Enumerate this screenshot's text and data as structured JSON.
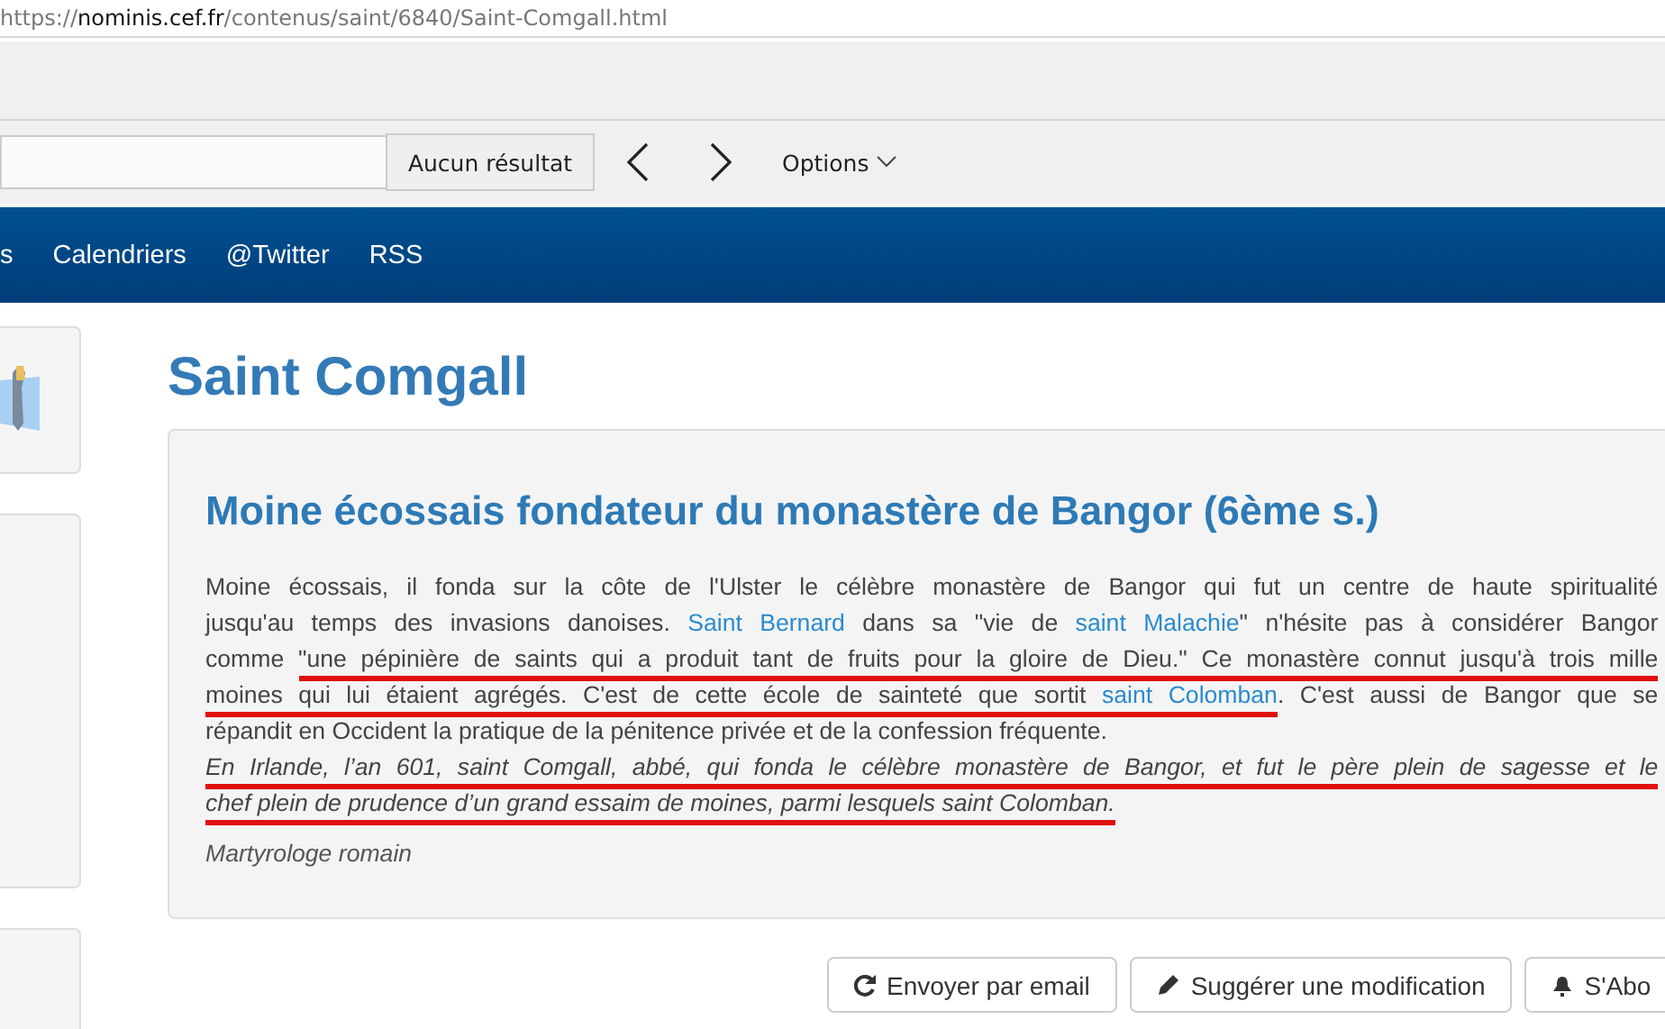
{
  "address_bar": {
    "scheme": "https://",
    "host": "nominis.cef.fr",
    "path": "/contenus/saint/6840/Saint-Comgall.html"
  },
  "find_bar": {
    "result_button": "Aucun résultat",
    "options": "Options"
  },
  "nav": [
    "s",
    "Calendriers",
    "@Twitter",
    "RSS"
  ],
  "sidebar_cards": [
    {
      "kind": "picture"
    },
    {
      "kind": "empty"
    },
    {
      "kind": "empty"
    }
  ],
  "title": "Saint Comgall",
  "panel": {
    "heading": "Moine écossais fondateur du monastère de Bangor (6ème s.)",
    "lines": [
      {
        "italic": false,
        "segments": [
          {
            "text": "Moine écossais, il fonda sur la côte de l'Ulster le célèbre monastère de Bangor qui fut un centre de haute spiritualité",
            "link": false,
            "marked": false
          }
        ]
      },
      {
        "italic": false,
        "segments": [
          {
            "text": "jusqu'au temps des invasions danoises. ",
            "link": false,
            "marked": false
          },
          {
            "text": "Saint Bernard",
            "link": true,
            "marked": false
          },
          {
            "text": " dans sa \"vie de ",
            "link": false,
            "marked": false
          },
          {
            "text": "saint Malachie",
            "link": true,
            "marked": false
          },
          {
            "text": "\" n'hésite pas à considérer Bangor",
            "link": false,
            "marked": false
          }
        ]
      },
      {
        "italic": false,
        "segments": [
          {
            "text": "comme ",
            "link": false,
            "marked": false
          },
          {
            "text": "\"une pépinière de saints qui a produit tant de fruits pour la gloire de Dieu.\" Ce monastère connut jusqu'à trois mille",
            "link": false,
            "marked": true
          }
        ]
      },
      {
        "italic": false,
        "segments": [
          {
            "text": "moines qui lui étaient agrégés. C'est de cette école de sainteté que sortit ",
            "link": false,
            "marked": true
          },
          {
            "text": "saint Colomban",
            "link": true,
            "marked": true
          },
          {
            "text": ". C'est aussi de Bangor que se",
            "link": false,
            "marked": false
          }
        ]
      },
      {
        "italic": false,
        "last": true,
        "segments": [
          {
            "text": "répandit en Occident la pratique de la pénitence privée et de la confession fréquente.",
            "link": false,
            "marked": false
          }
        ]
      },
      {
        "italic": true,
        "segments": [
          {
            "text": "En Irlande, l’an 601, saint Comgall, abbé, qui fonda le célèbre monastère de Bangor, et fut le père plein de sagesse et le",
            "link": false,
            "marked": true
          }
        ]
      },
      {
        "italic": true,
        "last": true,
        "segments": [
          {
            "text": "chef plein de prudence d’un grand essaim de moines, parmi lesquels saint Colomban.",
            "link": false,
            "marked": true
          }
        ]
      }
    ],
    "source": "Martyrologe romain"
  },
  "actions": [
    {
      "label": "Envoyer par email"
    },
    {
      "label": "Suggérer une modification"
    },
    {
      "label": "S'Abo"
    }
  ]
}
